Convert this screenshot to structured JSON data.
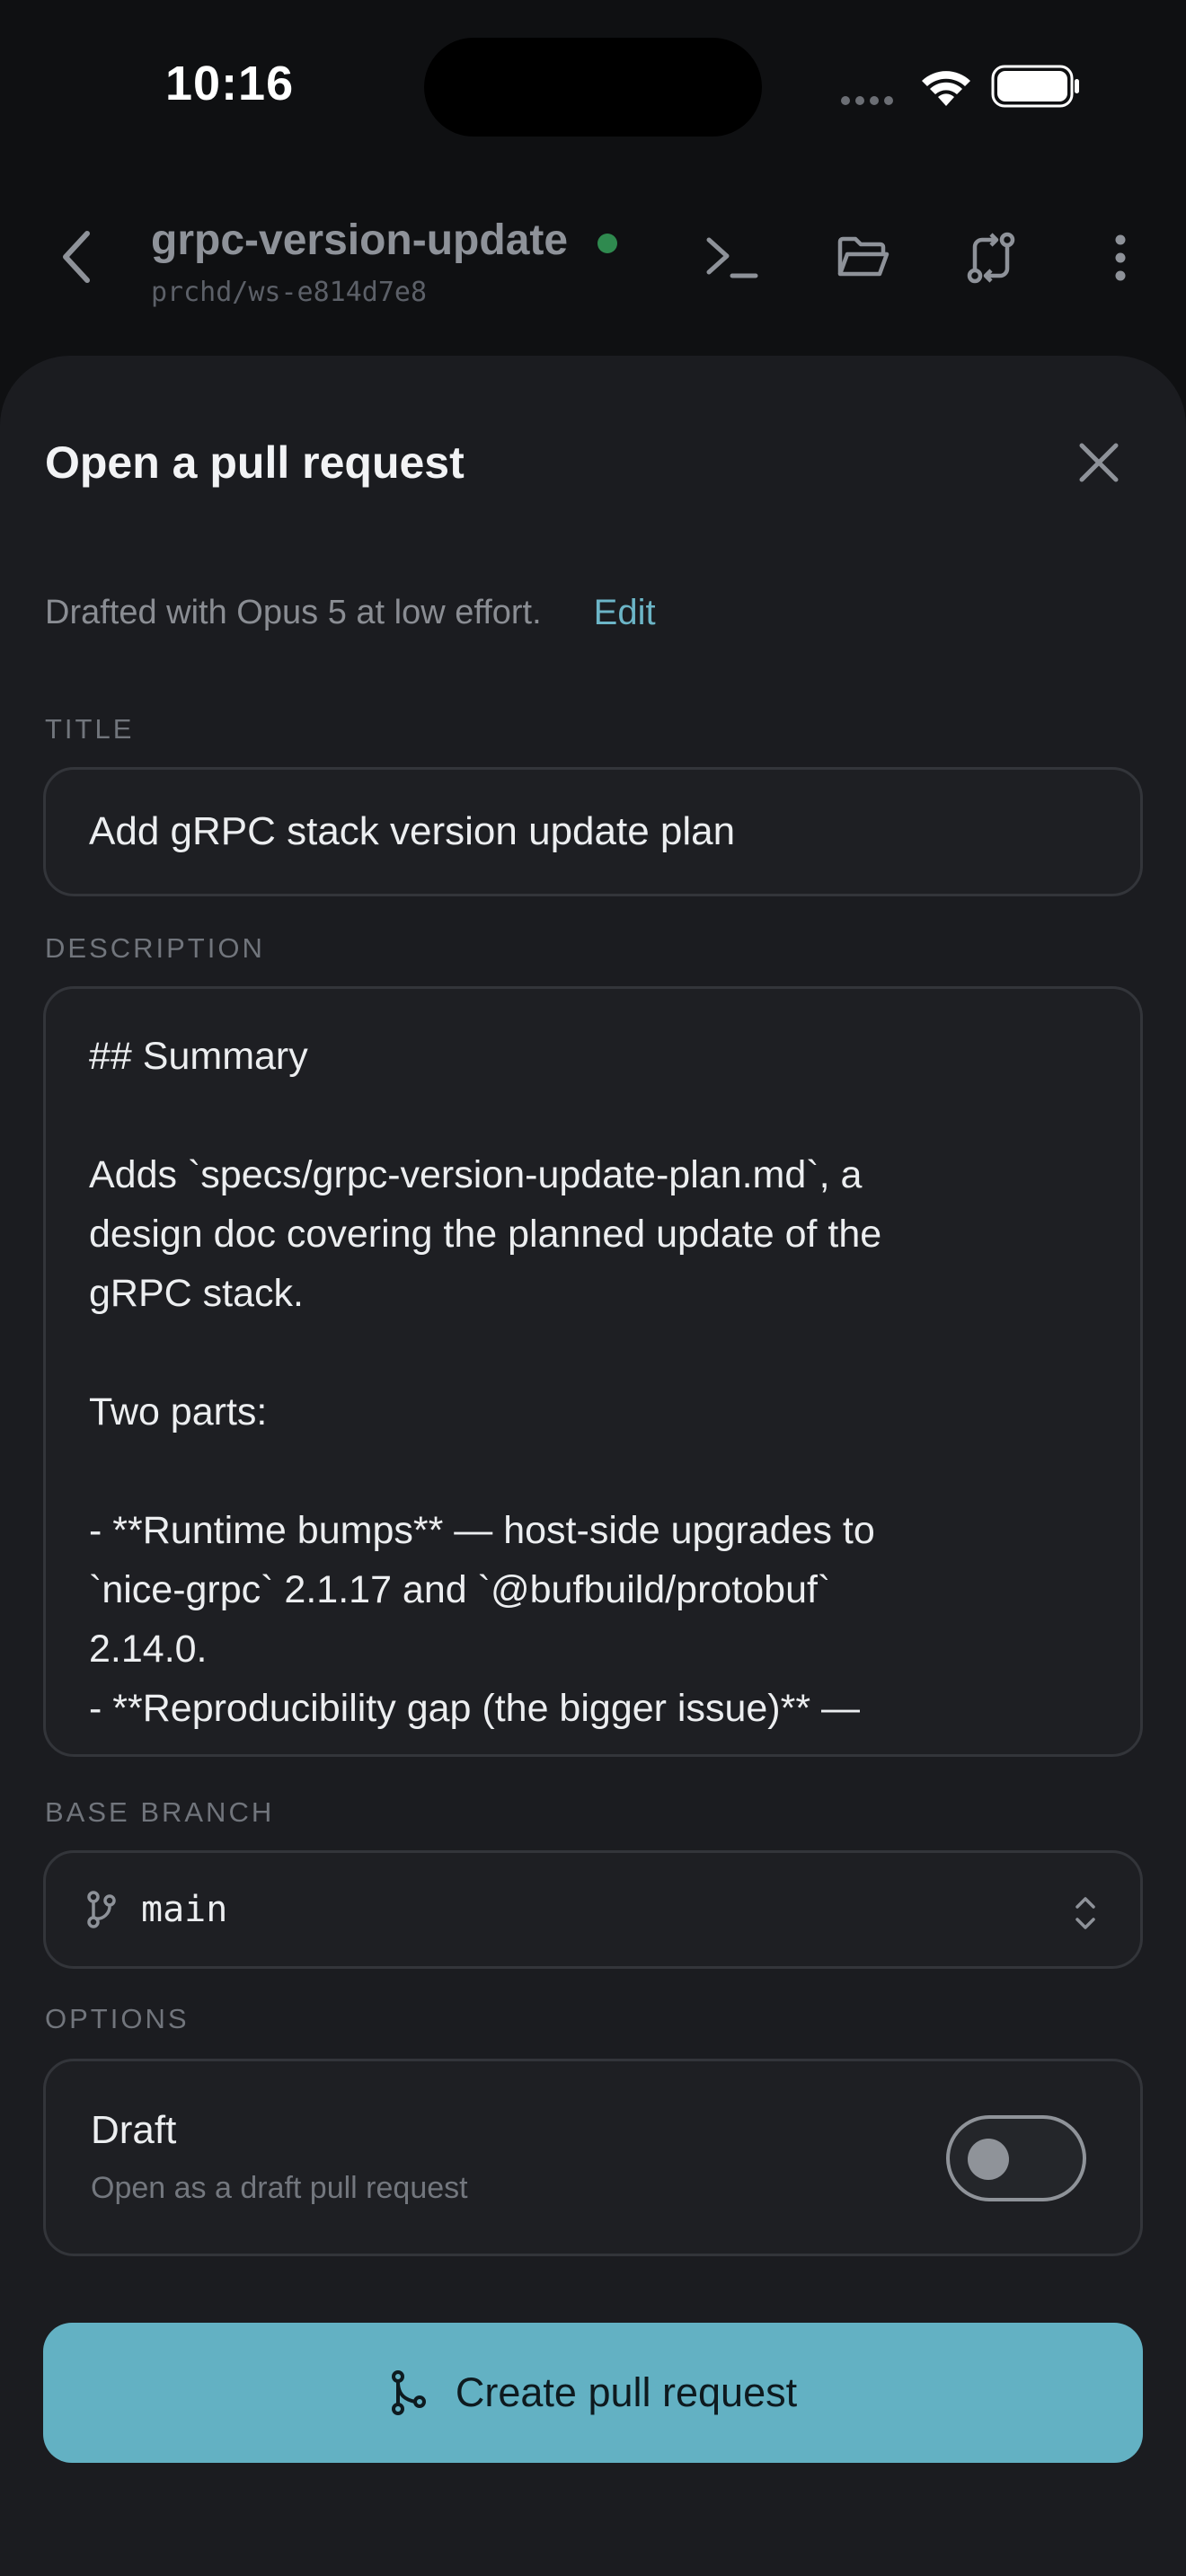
{
  "status_bar": {
    "time": "10:16",
    "icons": [
      "cellular-icon",
      "wifi-icon",
      "battery-icon"
    ]
  },
  "header": {
    "repo_name": "grpc-version-update",
    "workspace": "prchd/ws-e814d7e8",
    "status_color": "#2f8a4f",
    "icons": [
      "back-icon",
      "terminal-icon",
      "folder-icon",
      "pull-request-icon",
      "more-icon"
    ]
  },
  "sheet": {
    "title": "Open a pull request",
    "drafted_text": "Drafted with Opus 5 at low effort.",
    "edit_label": "Edit",
    "title_label": "TITLE",
    "title_value": "Add gRPC stack version update plan",
    "description_label": "DESCRIPTION",
    "description_lines": [
      "## Summary",
      "",
      "Adds `specs/grpc-version-update-plan.md`, a",
      "design doc covering the planned update of the",
      "gRPC stack.",
      "",
      "Two parts:",
      "",
      "- **Runtime bumps** — host-side upgrades to",
      "`nice-grpc` 2.1.17 and `@bufbuild/protobuf`",
      "2.14.0.",
      "- **Reproducibility gap (the bigger issue)** —"
    ],
    "base_branch_label": "BASE BRANCH",
    "base_branch_value": "main",
    "options_label": "OPTIONS",
    "draft_title": "Draft",
    "draft_subtitle": "Open as a draft pull request",
    "draft_enabled": false,
    "create_button_label": "Create pull request"
  },
  "colors": {
    "background": "#0f1012",
    "sheet": "#1b1c20",
    "accent": "#63b1c3",
    "link": "#6cb5c7"
  }
}
